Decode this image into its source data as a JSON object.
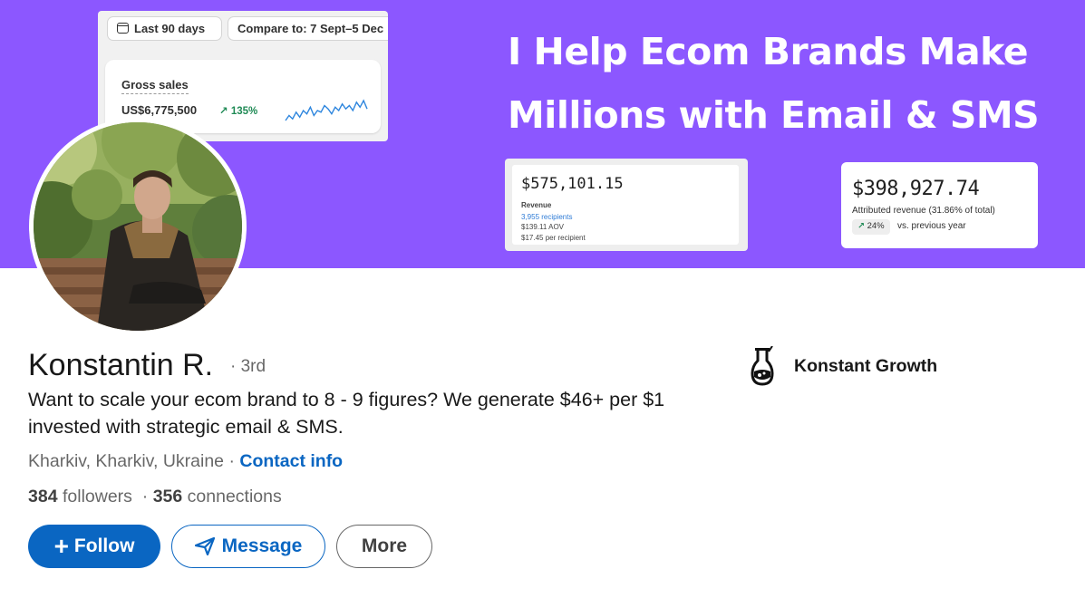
{
  "banner": {
    "headline": "I Help Ecom Brands Make Millions with Email & SMS",
    "background_color": "#8c57ff",
    "analytics_widget": {
      "date_range": "Last 90 days",
      "compare": "Compare to: 7 Sept–5 Dec",
      "metric_label": "Gross sales",
      "metric_value": "US$6,775,500",
      "metric_change": "↗ 135%",
      "sparkline": [
        6,
        9,
        7,
        11,
        8,
        12,
        10,
        14,
        9,
        12,
        11,
        15,
        13,
        10,
        14,
        12,
        16,
        13,
        15,
        12,
        17,
        14,
        18,
        13
      ]
    },
    "revenue_card": {
      "amount": "$575,101.15",
      "label": "Revenue",
      "recipients": "3,955 recipients",
      "aov": "$139.11 AOV",
      "per_recipient": "$17.45 per recipient"
    },
    "attributed_card": {
      "amount": "$398,927.74",
      "label": "Attributed revenue (31.86% of total)",
      "change": "24%",
      "change_suffix": "vs. previous year"
    }
  },
  "profile": {
    "name": "Konstantin R.",
    "degree": "· 3rd",
    "headline": "Want to scale your ecom brand to 8 - 9 figures? We generate $46+ per $1 invested with strategic email & SMS.",
    "location": "Kharkiv, Kharkiv, Ukraine",
    "separator": "·",
    "contact_info": "Contact info",
    "followers_count": "384",
    "followers_label": "followers",
    "connections_count": "356",
    "connections_label": "connections",
    "company": "Konstant Growth"
  },
  "actions": {
    "follow": "Follow",
    "message": "Message",
    "more": "More"
  },
  "colors": {
    "primary": "#0a66c2",
    "banner": "#8c57ff",
    "positive": "#1f8a55"
  }
}
